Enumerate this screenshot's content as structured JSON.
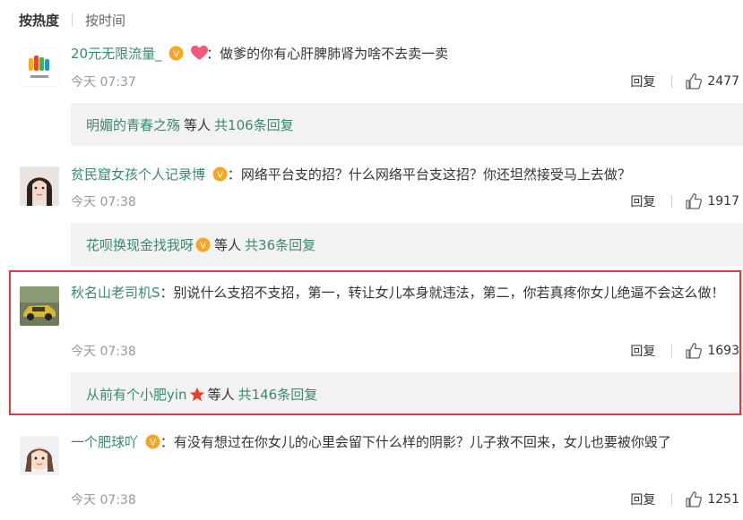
{
  "sort": {
    "active": "按热度",
    "inactive": "按时间"
  },
  "comments": [
    {
      "username": "20元无限流量_",
      "colon": "：",
      "text": "做爹的你有心肝脾肺肾为啥不去卖一卖",
      "time": "今天 07:37",
      "reply_label": "回复",
      "likes": "2477",
      "replies": {
        "name": "明媚的青春之殇",
        "mid": "等人",
        "count": "共106条回复"
      }
    },
    {
      "username": "贫民窟女孩个人记录博",
      "colon": "：",
      "text": "网络平台支的招？什么网络平台支这招？你还坦然接受马上去做？",
      "time": "今天 07:38",
      "reply_label": "回复",
      "likes": "1917",
      "replies": {
        "name": "花呗换现金找我呀",
        "mid": "等人",
        "count": "共36条回复"
      }
    },
    {
      "username": "秋名山老司机S",
      "colon": "：",
      "text": "别说什么支招不支招，第一，转让女儿本身就违法，第二，你若真疼你女儿绝逼不会这么做！",
      "time": "今天 07:38",
      "reply_label": "回复",
      "likes": "1693",
      "replies": {
        "name": "从前有个小肥yin",
        "mid": "等人",
        "count": "共146条回复"
      }
    },
    {
      "username": "一个肥球吖",
      "colon": "：",
      "text": "有没有想过在你女儿的心里会留下什么样的阴影？儿子救不回来，女儿也要被你毁了",
      "time": "今天 07:38",
      "reply_label": "回复",
      "likes": "1251"
    }
  ],
  "colors": {
    "link": "#3a8a6a",
    "highlight": "#e23b3b",
    "reply_bg": "#f2f2f2"
  }
}
